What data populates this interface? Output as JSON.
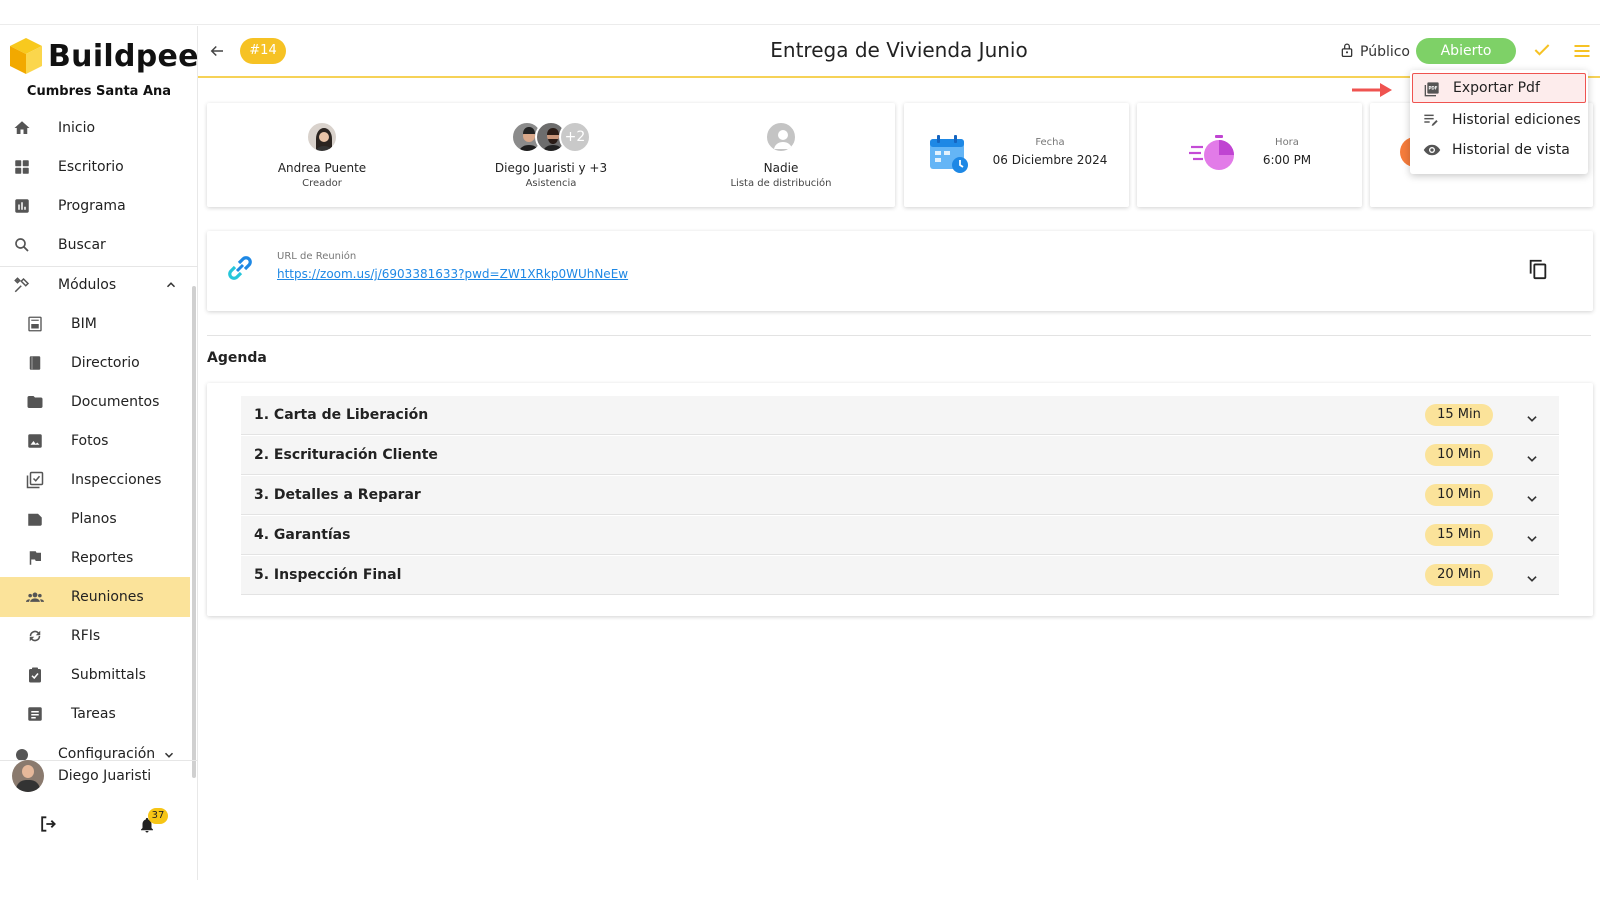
{
  "app": {
    "logo_text": "Buildpeer",
    "project_name": "Cumbres Santa Ana"
  },
  "sidebar": {
    "items": [
      {
        "label": "Inicio",
        "icon": "home-icon"
      },
      {
        "label": "Escritorio",
        "icon": "dashboard-icon"
      },
      {
        "label": "Programa",
        "icon": "chart-icon"
      },
      {
        "label": "Buscar",
        "icon": "search-icon"
      },
      {
        "label": "Módulos",
        "icon": "tools-icon"
      }
    ],
    "modules": [
      {
        "label": "BIM",
        "icon": "bim-icon"
      },
      {
        "label": "Directorio",
        "icon": "book-icon"
      },
      {
        "label": "Documentos",
        "icon": "folder-icon"
      },
      {
        "label": "Fotos",
        "icon": "image-icon"
      },
      {
        "label": "Inspecciones",
        "icon": "checklist-icon"
      },
      {
        "label": "Planos",
        "icon": "plans-icon"
      },
      {
        "label": "Reportes",
        "icon": "flag-icon"
      },
      {
        "label": "Reuniones",
        "icon": "group-icon",
        "active": true
      },
      {
        "label": "RFIs",
        "icon": "sync-icon"
      },
      {
        "label": "Submittals",
        "icon": "clipboard-check-icon"
      },
      {
        "label": "Tareas",
        "icon": "notes-icon"
      }
    ],
    "config_label": "Configuración",
    "user_name": "Diego Juaristi",
    "notification_count": "37"
  },
  "header": {
    "number": "#14",
    "title": "Entrega de Vivienda Junio",
    "visibility": "Público",
    "status": "Abierto"
  },
  "menu": {
    "items": [
      {
        "label": "Exportar Pdf",
        "icon": "pdf-icon"
      },
      {
        "label": "Historial ediciones",
        "icon": "edit-history-icon"
      },
      {
        "label": "Historial de vista",
        "icon": "eye-icon"
      }
    ]
  },
  "participants": {
    "creator": {
      "name": "Andrea Puente",
      "role": "Creador"
    },
    "attendance": {
      "name": "Diego Juaristi y +3",
      "role": "Asistencia",
      "extra": "+2"
    },
    "distribution": {
      "name": "Nadie",
      "role": "Lista de distribución"
    }
  },
  "date": {
    "label": "Fecha",
    "value": "06 Diciembre 2024"
  },
  "time": {
    "label": "Hora",
    "value": "6:00 PM"
  },
  "meeting_url": {
    "label": "URL de Reunión",
    "url": "https://zoom.us/j/6903381633?pwd=ZW1XRkp0WUhNeEw"
  },
  "agenda": {
    "title": "Agenda",
    "items": [
      {
        "title": "1. Carta de Liberación",
        "duration": "15 Min"
      },
      {
        "title": "2. Escrituración Cliente",
        "duration": "10 Min"
      },
      {
        "title": "3. Detalles a Reparar",
        "duration": "10 Min"
      },
      {
        "title": "4. Garantías",
        "duration": "15 Min"
      },
      {
        "title": "5. Inspección Final",
        "duration": "20 Min"
      }
    ]
  },
  "colors": {
    "accent": "#f6c224",
    "active_bg": "#fbe39a",
    "status_green": "#7ed167",
    "link_blue": "#1e88e5",
    "highlight_red": "#ef5350"
  }
}
